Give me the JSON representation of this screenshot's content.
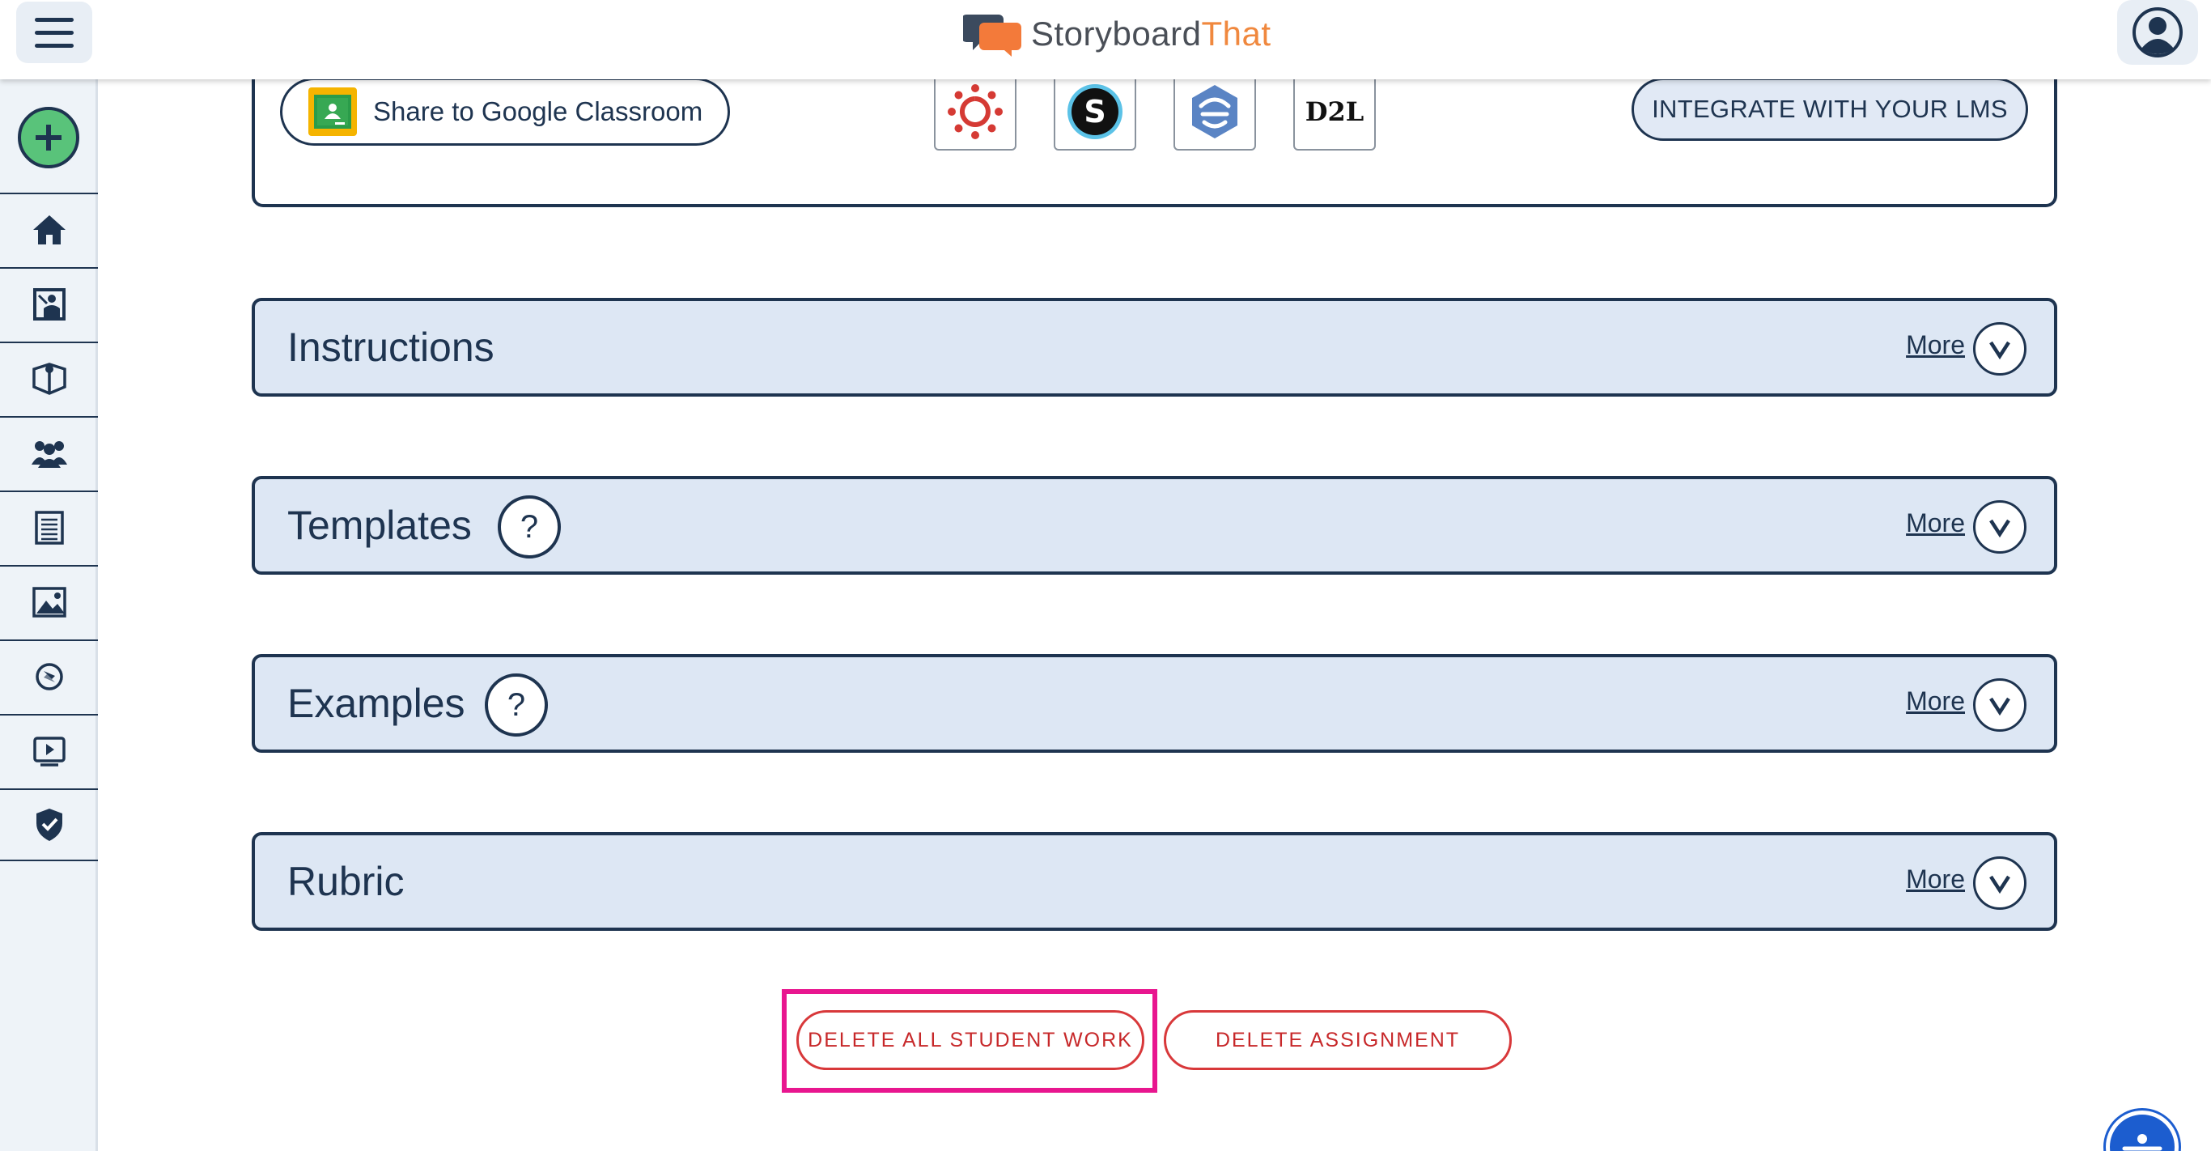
{
  "app": {
    "logo_part1": "Storyboard",
    "logo_part2": "That"
  },
  "sidebar": {
    "items": [
      {
        "icon": "home-icon"
      },
      {
        "icon": "teacher-icon"
      },
      {
        "icon": "lesson-plans-icon"
      },
      {
        "icon": "students-icon"
      },
      {
        "icon": "worksheet-icon"
      },
      {
        "icon": "image-icon"
      },
      {
        "icon": "compass-icon"
      },
      {
        "icon": "video-icon"
      },
      {
        "icon": "shield-check-icon"
      }
    ]
  },
  "lms": {
    "google_classroom_label": "Share to Google Classroom",
    "d2l_label": "D2L",
    "integrate_label": "INTEGRATE WITH YOUR LMS"
  },
  "sections": [
    {
      "title": "Instructions",
      "more": "More",
      "help": ""
    },
    {
      "title": "Templates",
      "more": "More",
      "help": "?"
    },
    {
      "title": "Examples",
      "more": "More",
      "help": "?"
    },
    {
      "title": "Rubric",
      "more": "More",
      "help": ""
    }
  ],
  "actions": {
    "delete_student_work": "DELETE ALL STUDENT WORK",
    "delete_assignment": "DELETE ASSIGNMENT"
  },
  "colors": {
    "navy": "#1e3450",
    "section_bg": "#dde7f4",
    "danger": "#c7282a",
    "highlight": "#e8168f",
    "brand_orange": "#f0883e"
  }
}
